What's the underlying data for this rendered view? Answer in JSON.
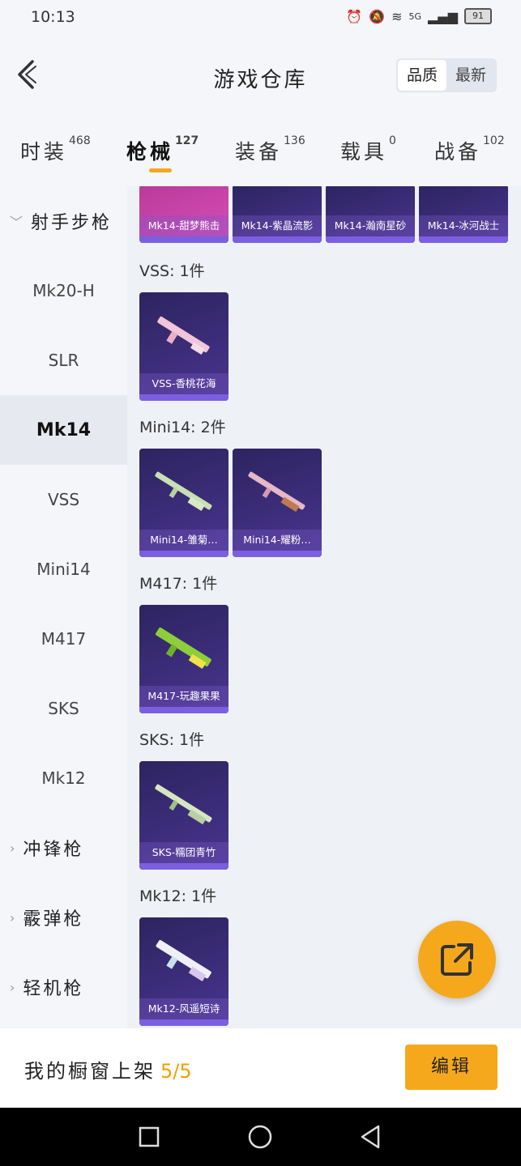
{
  "status": {
    "time": "10:13",
    "signal_label": "5G",
    "battery": "91"
  },
  "header": {
    "title": "游戏仓库",
    "sort_quality": "品质",
    "sort_newest": "最新"
  },
  "tabs": [
    {
      "label": "时装",
      "count": "468"
    },
    {
      "label": "枪械",
      "count": "127"
    },
    {
      "label": "装备",
      "count": "136"
    },
    {
      "label": "载具",
      "count": "0"
    },
    {
      "label": "战备",
      "count": "102"
    }
  ],
  "sidebar": {
    "items": [
      {
        "label": "射手步枪",
        "type": "category"
      },
      {
        "label": "Mk20-H"
      },
      {
        "label": "SLR"
      },
      {
        "label": "Mk14"
      },
      {
        "label": "VSS"
      },
      {
        "label": "Mini14"
      },
      {
        "label": "M417"
      },
      {
        "label": "SKS"
      },
      {
        "label": "Mk12"
      },
      {
        "label": "冲锋枪",
        "type": "category"
      },
      {
        "label": "霰弹枪",
        "type": "category"
      },
      {
        "label": "轻机枪",
        "type": "category"
      }
    ]
  },
  "content": {
    "top_row": [
      "Mk14-甜梦熊击",
      "Mk14-紫晶流影",
      "Mk14-瀚南星砂",
      "Mk14-冰河战士"
    ],
    "groups": [
      {
        "label": "VSS: 1件",
        "items": [
          "VSS-香桃花海"
        ]
      },
      {
        "label": "Mini14: 2件",
        "items": [
          "Mini14-雏菊…",
          "Mini14-耀粉…"
        ]
      },
      {
        "label": "M417: 1件",
        "items": [
          "M417-玩趣果果"
        ]
      },
      {
        "label": "SKS: 1件",
        "items": [
          "SKS-糯团青竹"
        ]
      },
      {
        "label": "Mk12: 1件",
        "items": [
          "Mk12-风遥短诗"
        ]
      }
    ]
  },
  "bottom": {
    "showcase_label": "我的橱窗上架",
    "showcase_count": "5/5",
    "edit_label": "编辑"
  },
  "colors": {
    "accent": "#f6a81d",
    "card_purple": "#3c2d7a",
    "card_pink": "#d84fb8"
  }
}
